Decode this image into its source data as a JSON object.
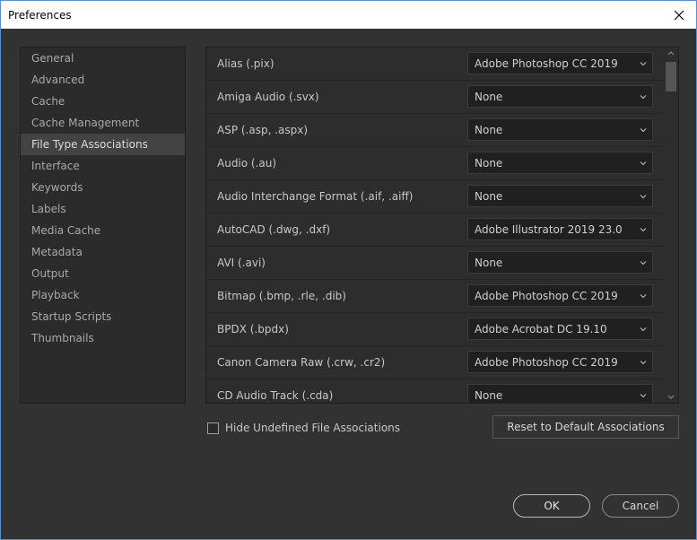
{
  "window": {
    "title": "Preferences"
  },
  "sidebar": {
    "items": [
      {
        "label": "General"
      },
      {
        "label": "Advanced"
      },
      {
        "label": "Cache"
      },
      {
        "label": "Cache Management"
      },
      {
        "label": "File Type Associations",
        "selected": true
      },
      {
        "label": "Interface"
      },
      {
        "label": "Keywords"
      },
      {
        "label": "Labels"
      },
      {
        "label": "Media Cache"
      },
      {
        "label": "Metadata"
      },
      {
        "label": "Output"
      },
      {
        "label": "Playback"
      },
      {
        "label": "Startup Scripts"
      },
      {
        "label": "Thumbnails"
      }
    ]
  },
  "associations": {
    "rows": [
      {
        "type": "Alias (.pix)",
        "app": "Adobe Photoshop CC 2019"
      },
      {
        "type": "Amiga Audio (.svx)",
        "app": "None"
      },
      {
        "type": "ASP (.asp, .aspx)",
        "app": "None"
      },
      {
        "type": "Audio (.au)",
        "app": "None"
      },
      {
        "type": "Audio Interchange Format (.aif, .aiff)",
        "app": "None"
      },
      {
        "type": "AutoCAD (.dwg, .dxf)",
        "app": "Adobe Illustrator 2019 23.0"
      },
      {
        "type": "AVI (.avi)",
        "app": "None"
      },
      {
        "type": "Bitmap (.bmp, .rle, .dib)",
        "app": "Adobe Photoshop CC 2019"
      },
      {
        "type": "BPDX (.bpdx)",
        "app": "Adobe Acrobat DC 19.10"
      },
      {
        "type": "Canon Camera Raw (.crw, .cr2)",
        "app": "Adobe Photoshop CC 2019"
      },
      {
        "type": "CD Audio Track (.cda)",
        "app": "None"
      }
    ]
  },
  "options": {
    "hide_undefined_label": "Hide Undefined File Associations",
    "hide_undefined_checked": false
  },
  "buttons": {
    "reset": "Reset to Default Associations",
    "ok": "OK",
    "cancel": "Cancel"
  },
  "colors": {
    "background": "#323232",
    "panel": "#2d2d2d",
    "selected": "#434343",
    "titlebar": "#ffffff"
  }
}
